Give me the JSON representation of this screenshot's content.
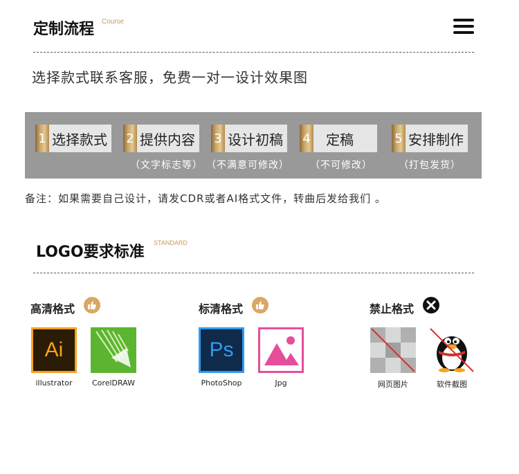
{
  "header": {
    "title": "定制流程",
    "title_en": "Course"
  },
  "intro": "选择款式联系客服，免费一对一设计效果图",
  "steps": [
    {
      "num": "1",
      "label": "选择款式",
      "note": ""
    },
    {
      "num": "2",
      "label": "提供内容",
      "note": "（文字标志等）"
    },
    {
      "num": "3",
      "label": "设计初稿",
      "note": "（不满意可修改）"
    },
    {
      "num": "4",
      "label": "定稿",
      "note": "（不可修改）"
    },
    {
      "num": "5",
      "label": "安排制作",
      "note": "（打包发货）"
    }
  ],
  "remark": "备注：如果需要自己设计，请发CDR或者AI格式文件，转曲后发给我们 。",
  "logo_section": {
    "title": "LOGO要求标准",
    "title_en": "STANDARD"
  },
  "categories": [
    {
      "label": "高清格式",
      "items": [
        "illustrator",
        "CorelDRAW"
      ]
    },
    {
      "label": "标清格式",
      "items": [
        "PhotoShop",
        "Jpg"
      ]
    },
    {
      "label": "禁止格式",
      "items": [
        "网页图片",
        "软件截图"
      ]
    }
  ],
  "icons": {
    "ai_text": "Ai",
    "ps_text": "Ps"
  },
  "colors": {
    "accent_gold": "#c89a5a",
    "band_gray": "#9a999a",
    "ai_orange": "#f7a21b",
    "ps_blue": "#2f9bf0",
    "corel_green": "#5cb531",
    "jpg_pink": "#e64d9b"
  }
}
